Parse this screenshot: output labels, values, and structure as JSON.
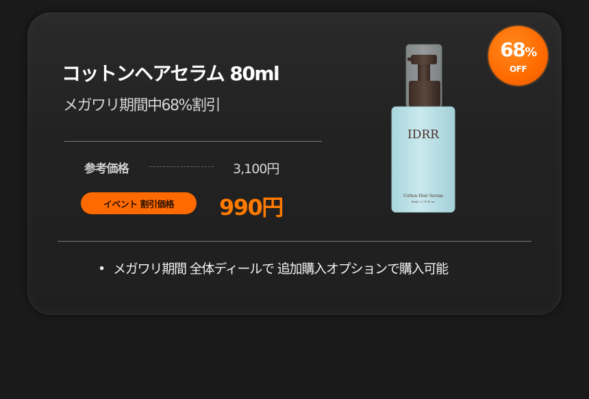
{
  "product": {
    "title": "コットンヘアセラム 80ml",
    "subtitle": "メガワリ期間中68%割引",
    "image": {
      "brand": "IDRR",
      "name": "Cotton Hair Serum",
      "volume": "80ml / 2.70 fl. oz."
    }
  },
  "pricing": {
    "reference_label": "参考価格",
    "reference_price": "3,100円",
    "event_label": "イベント 割引価格",
    "sale_price": "990円"
  },
  "discount_badge": {
    "percent": "68",
    "percent_sign": "%",
    "off": "OFF"
  },
  "notes": [
    "メガワリ期間 全体ディールで 追加購入オプションで購入可能"
  ],
  "colors": {
    "background": "#1a1a1a",
    "card": "#242424",
    "accent": "#ff6a00",
    "sale_price": "#ff7a00",
    "bottle": "#b9e0e6",
    "pump": "#4a3a32"
  }
}
